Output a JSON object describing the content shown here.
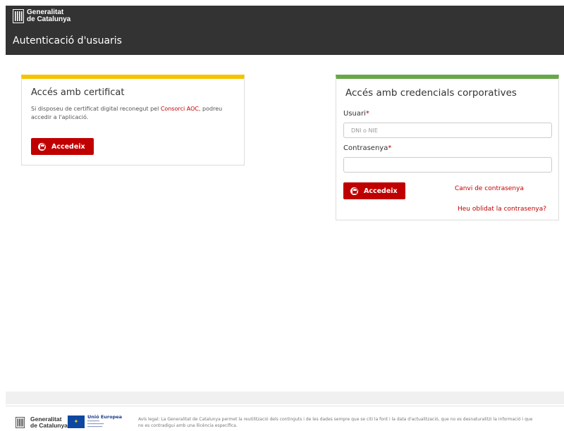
{
  "header": {
    "brand_line1": "Generalitat",
    "brand_line2": "de Catalunya",
    "title": "Autenticació d'usuaris"
  },
  "cert_panel": {
    "title": "Accés amb certificat",
    "text_part1": "Si disposeu de certificat digital reconegut pel ",
    "link_text": "Consorci AOC",
    "text_part2": ", podreu accedir a l'aplicació.",
    "button_label": "Accedeix",
    "accent_color": "#f5c300"
  },
  "cred_panel": {
    "title": "Accés amb credencials corporatives",
    "user_label": "Usuari",
    "user_placeholder": "DNI o NIE",
    "user_value": "",
    "password_label": "Contrasenya",
    "password_value": "",
    "required_mark": "*",
    "button_label": "Accedeix",
    "change_password_link": "Canvi de contrasenya",
    "forgot_password_link": "Heu oblidat la contrasenya?",
    "accent_color": "#6aa64a"
  },
  "footer": {
    "brand_line1": "Generalitat",
    "brand_line2": "de Catalunya",
    "eu_title": "Unió Europea",
    "legal_text": "Avís legal: La Generalitat de Catalunya permet la reutilització dels continguts i de les dades sempre que se citi la font i la data d'actualització, que no es desnaturalitzi la informació i que no es contradigui amb una llicència específica."
  },
  "colors": {
    "header_bg": "#333333",
    "primary_red": "#c00000"
  }
}
